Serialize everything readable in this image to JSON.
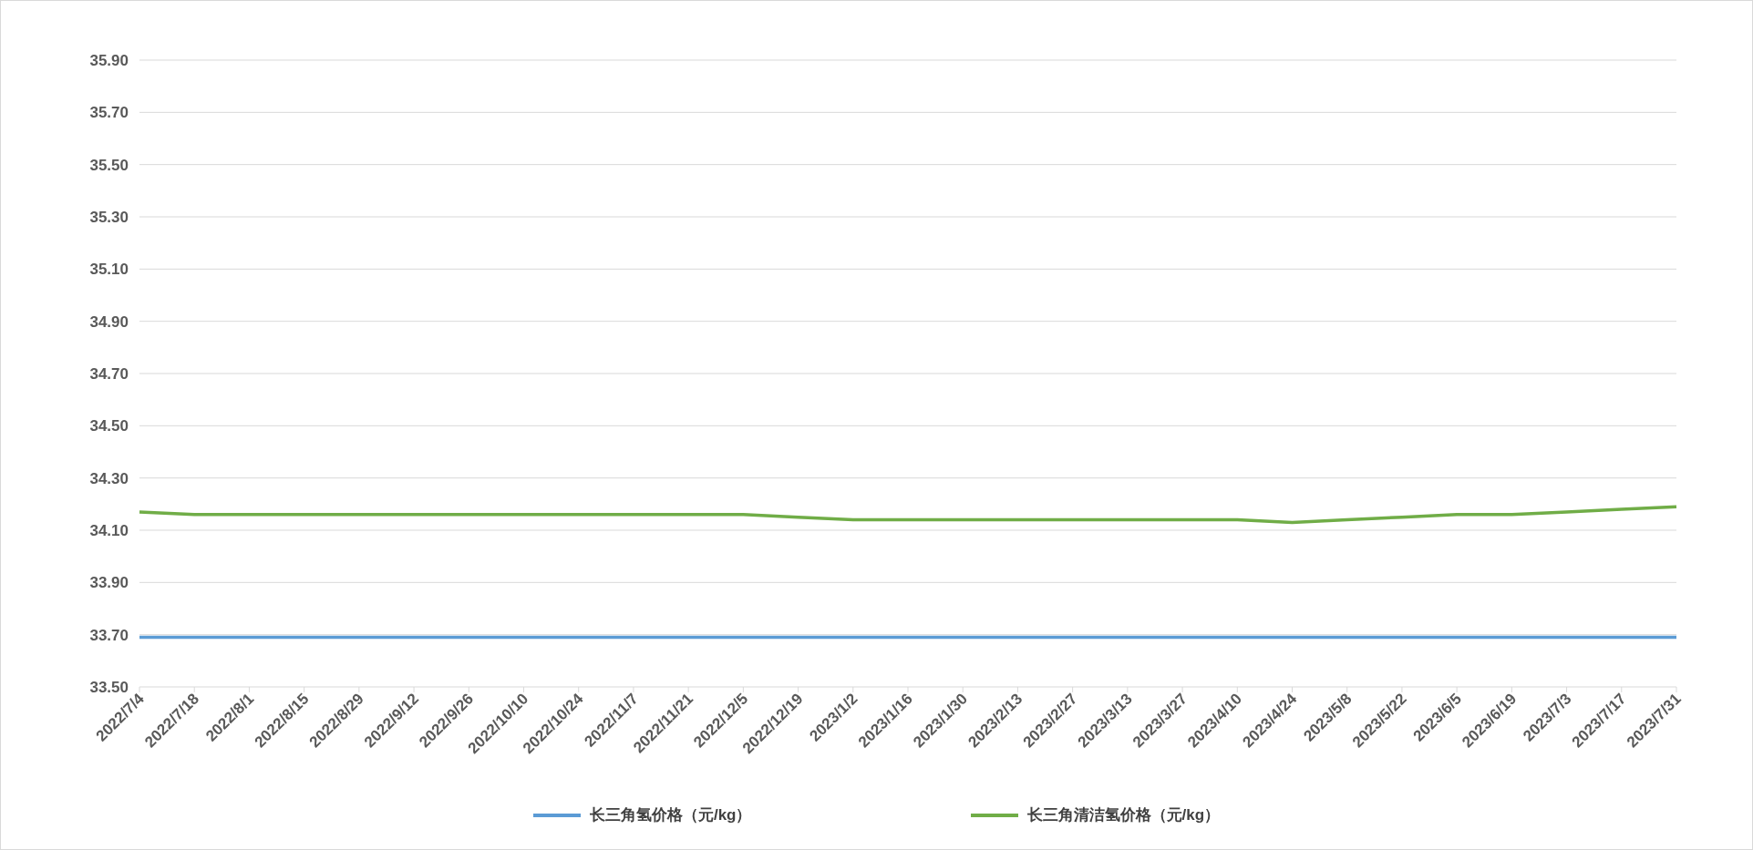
{
  "chart_data": {
    "type": "line",
    "categories": [
      "2022/7/4",
      "2022/7/18",
      "2022/8/1",
      "2022/8/15",
      "2022/8/29",
      "2022/9/12",
      "2022/9/26",
      "2022/10/10",
      "2022/10/24",
      "2022/11/7",
      "2022/11/21",
      "2022/12/5",
      "2022/12/19",
      "2023/1/2",
      "2023/1/16",
      "2023/1/30",
      "2023/2/13",
      "2023/2/27",
      "2023/3/13",
      "2023/3/27",
      "2023/4/10",
      "2023/4/24",
      "2023/5/8",
      "2023/5/22",
      "2023/6/5",
      "2023/6/19",
      "2023/7/3",
      "2023/7/17",
      "2023/7/31"
    ],
    "series": [
      {
        "name": "长三角氢价格（元/kg）",
        "color": "#5b9bd5",
        "values": [
          33.69,
          33.69,
          33.69,
          33.69,
          33.69,
          33.69,
          33.69,
          33.69,
          33.69,
          33.69,
          33.69,
          33.69,
          33.69,
          33.69,
          33.69,
          33.69,
          33.69,
          33.69,
          33.69,
          33.69,
          33.69,
          33.69,
          33.69,
          33.69,
          33.69,
          33.69,
          33.69,
          33.69,
          33.69
        ]
      },
      {
        "name": "长三角清洁氢价格（元/kg）",
        "color": "#70ad47",
        "values": [
          34.17,
          34.16,
          34.16,
          34.16,
          34.16,
          34.16,
          34.16,
          34.16,
          34.16,
          34.16,
          34.16,
          34.16,
          34.15,
          34.14,
          34.14,
          34.14,
          34.14,
          34.14,
          34.14,
          34.14,
          34.14,
          34.13,
          34.14,
          34.15,
          34.16,
          34.16,
          34.17,
          34.18,
          34.19
        ]
      }
    ],
    "ylim": [
      33.5,
      35.9
    ],
    "grid": true,
    "yticks": [
      {
        "value": 33.5,
        "label": "33.50"
      },
      {
        "value": 33.7,
        "label": "33.70"
      },
      {
        "value": 33.9,
        "label": "33.90"
      },
      {
        "value": 34.1,
        "label": "34.10"
      },
      {
        "value": 34.3,
        "label": "34.30"
      },
      {
        "value": 34.5,
        "label": "34.50"
      },
      {
        "value": 34.7,
        "label": "34.70"
      },
      {
        "value": 34.9,
        "label": "34.90"
      },
      {
        "value": 35.1,
        "label": "35.10"
      },
      {
        "value": 35.3,
        "label": "35.30"
      },
      {
        "value": 35.5,
        "label": "35.50"
      },
      {
        "value": 35.7,
        "label": "35.70"
      },
      {
        "value": 35.9,
        "label": "35.90"
      }
    ]
  }
}
